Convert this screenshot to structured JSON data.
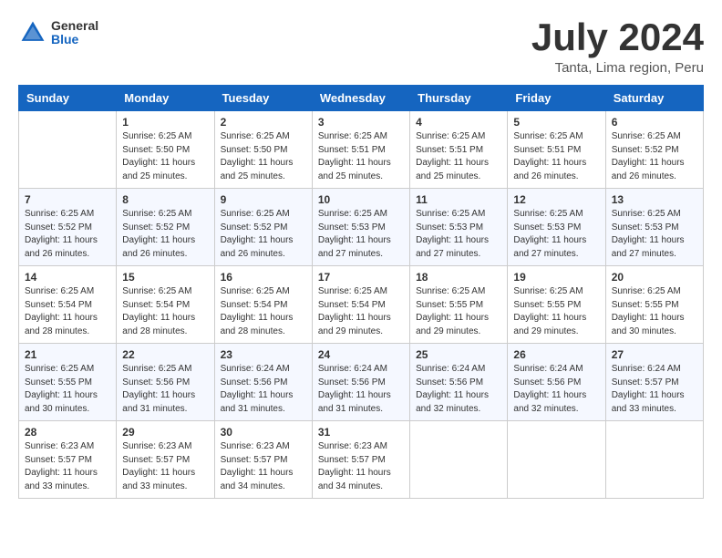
{
  "header": {
    "logo_general": "General",
    "logo_blue": "Blue",
    "month_title": "July 2024",
    "location": "Tanta, Lima region, Peru"
  },
  "calendar": {
    "days_of_week": [
      "Sunday",
      "Monday",
      "Tuesday",
      "Wednesday",
      "Thursday",
      "Friday",
      "Saturday"
    ],
    "weeks": [
      [
        {
          "day": "",
          "sunrise": "",
          "sunset": "",
          "daylight": ""
        },
        {
          "day": "1",
          "sunrise": "Sunrise: 6:25 AM",
          "sunset": "Sunset: 5:50 PM",
          "daylight": "Daylight: 11 hours and 25 minutes."
        },
        {
          "day": "2",
          "sunrise": "Sunrise: 6:25 AM",
          "sunset": "Sunset: 5:50 PM",
          "daylight": "Daylight: 11 hours and 25 minutes."
        },
        {
          "day": "3",
          "sunrise": "Sunrise: 6:25 AM",
          "sunset": "Sunset: 5:51 PM",
          "daylight": "Daylight: 11 hours and 25 minutes."
        },
        {
          "day": "4",
          "sunrise": "Sunrise: 6:25 AM",
          "sunset": "Sunset: 5:51 PM",
          "daylight": "Daylight: 11 hours and 25 minutes."
        },
        {
          "day": "5",
          "sunrise": "Sunrise: 6:25 AM",
          "sunset": "Sunset: 5:51 PM",
          "daylight": "Daylight: 11 hours and 26 minutes."
        },
        {
          "day": "6",
          "sunrise": "Sunrise: 6:25 AM",
          "sunset": "Sunset: 5:52 PM",
          "daylight": "Daylight: 11 hours and 26 minutes."
        }
      ],
      [
        {
          "day": "7",
          "sunrise": "Sunrise: 6:25 AM",
          "sunset": "Sunset: 5:52 PM",
          "daylight": "Daylight: 11 hours and 26 minutes."
        },
        {
          "day": "8",
          "sunrise": "Sunrise: 6:25 AM",
          "sunset": "Sunset: 5:52 PM",
          "daylight": "Daylight: 11 hours and 26 minutes."
        },
        {
          "day": "9",
          "sunrise": "Sunrise: 6:25 AM",
          "sunset": "Sunset: 5:52 PM",
          "daylight": "Daylight: 11 hours and 26 minutes."
        },
        {
          "day": "10",
          "sunrise": "Sunrise: 6:25 AM",
          "sunset": "Sunset: 5:53 PM",
          "daylight": "Daylight: 11 hours and 27 minutes."
        },
        {
          "day": "11",
          "sunrise": "Sunrise: 6:25 AM",
          "sunset": "Sunset: 5:53 PM",
          "daylight": "Daylight: 11 hours and 27 minutes."
        },
        {
          "day": "12",
          "sunrise": "Sunrise: 6:25 AM",
          "sunset": "Sunset: 5:53 PM",
          "daylight": "Daylight: 11 hours and 27 minutes."
        },
        {
          "day": "13",
          "sunrise": "Sunrise: 6:25 AM",
          "sunset": "Sunset: 5:53 PM",
          "daylight": "Daylight: 11 hours and 27 minutes."
        }
      ],
      [
        {
          "day": "14",
          "sunrise": "Sunrise: 6:25 AM",
          "sunset": "Sunset: 5:54 PM",
          "daylight": "Daylight: 11 hours and 28 minutes."
        },
        {
          "day": "15",
          "sunrise": "Sunrise: 6:25 AM",
          "sunset": "Sunset: 5:54 PM",
          "daylight": "Daylight: 11 hours and 28 minutes."
        },
        {
          "day": "16",
          "sunrise": "Sunrise: 6:25 AM",
          "sunset": "Sunset: 5:54 PM",
          "daylight": "Daylight: 11 hours and 28 minutes."
        },
        {
          "day": "17",
          "sunrise": "Sunrise: 6:25 AM",
          "sunset": "Sunset: 5:54 PM",
          "daylight": "Daylight: 11 hours and 29 minutes."
        },
        {
          "day": "18",
          "sunrise": "Sunrise: 6:25 AM",
          "sunset": "Sunset: 5:55 PM",
          "daylight": "Daylight: 11 hours and 29 minutes."
        },
        {
          "day": "19",
          "sunrise": "Sunrise: 6:25 AM",
          "sunset": "Sunset: 5:55 PM",
          "daylight": "Daylight: 11 hours and 29 minutes."
        },
        {
          "day": "20",
          "sunrise": "Sunrise: 6:25 AM",
          "sunset": "Sunset: 5:55 PM",
          "daylight": "Daylight: 11 hours and 30 minutes."
        }
      ],
      [
        {
          "day": "21",
          "sunrise": "Sunrise: 6:25 AM",
          "sunset": "Sunset: 5:55 PM",
          "daylight": "Daylight: 11 hours and 30 minutes."
        },
        {
          "day": "22",
          "sunrise": "Sunrise: 6:25 AM",
          "sunset": "Sunset: 5:56 PM",
          "daylight": "Daylight: 11 hours and 31 minutes."
        },
        {
          "day": "23",
          "sunrise": "Sunrise: 6:24 AM",
          "sunset": "Sunset: 5:56 PM",
          "daylight": "Daylight: 11 hours and 31 minutes."
        },
        {
          "day": "24",
          "sunrise": "Sunrise: 6:24 AM",
          "sunset": "Sunset: 5:56 PM",
          "daylight": "Daylight: 11 hours and 31 minutes."
        },
        {
          "day": "25",
          "sunrise": "Sunrise: 6:24 AM",
          "sunset": "Sunset: 5:56 PM",
          "daylight": "Daylight: 11 hours and 32 minutes."
        },
        {
          "day": "26",
          "sunrise": "Sunrise: 6:24 AM",
          "sunset": "Sunset: 5:56 PM",
          "daylight": "Daylight: 11 hours and 32 minutes."
        },
        {
          "day": "27",
          "sunrise": "Sunrise: 6:24 AM",
          "sunset": "Sunset: 5:57 PM",
          "daylight": "Daylight: 11 hours and 33 minutes."
        }
      ],
      [
        {
          "day": "28",
          "sunrise": "Sunrise: 6:23 AM",
          "sunset": "Sunset: 5:57 PM",
          "daylight": "Daylight: 11 hours and 33 minutes."
        },
        {
          "day": "29",
          "sunrise": "Sunrise: 6:23 AM",
          "sunset": "Sunset: 5:57 PM",
          "daylight": "Daylight: 11 hours and 33 minutes."
        },
        {
          "day": "30",
          "sunrise": "Sunrise: 6:23 AM",
          "sunset": "Sunset: 5:57 PM",
          "daylight": "Daylight: 11 hours and 34 minutes."
        },
        {
          "day": "31",
          "sunrise": "Sunrise: 6:23 AM",
          "sunset": "Sunset: 5:57 PM",
          "daylight": "Daylight: 11 hours and 34 minutes."
        },
        {
          "day": "",
          "sunrise": "",
          "sunset": "",
          "daylight": ""
        },
        {
          "day": "",
          "sunrise": "",
          "sunset": "",
          "daylight": ""
        },
        {
          "day": "",
          "sunrise": "",
          "sunset": "",
          "daylight": ""
        }
      ]
    ]
  }
}
